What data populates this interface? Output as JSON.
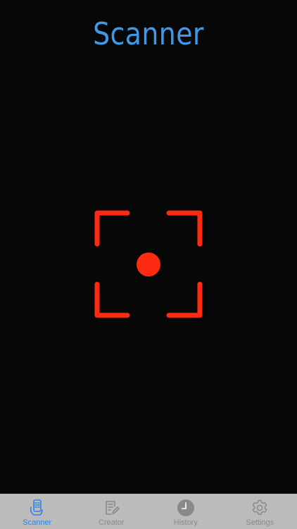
{
  "header": {
    "title": "Scanner"
  },
  "colors": {
    "title": "#3f99e8",
    "viewfinder": "#ff2a12",
    "background": "#070707",
    "tabbar": "#bbbbbb",
    "tab_active": "#2f82e6",
    "tab_inactive": "#8a8a8a"
  },
  "viewfinder": {
    "icon": "scan-target-icon"
  },
  "tabbar": {
    "active": "scanner",
    "tabs": [
      {
        "id": "scanner",
        "label": "Scanner",
        "icon": "phone-scan-icon"
      },
      {
        "id": "creator",
        "label": "Creator",
        "icon": "document-edit-icon"
      },
      {
        "id": "history",
        "label": "History",
        "icon": "clock-icon"
      },
      {
        "id": "settings",
        "label": "Settings",
        "icon": "gear-icon"
      }
    ]
  }
}
